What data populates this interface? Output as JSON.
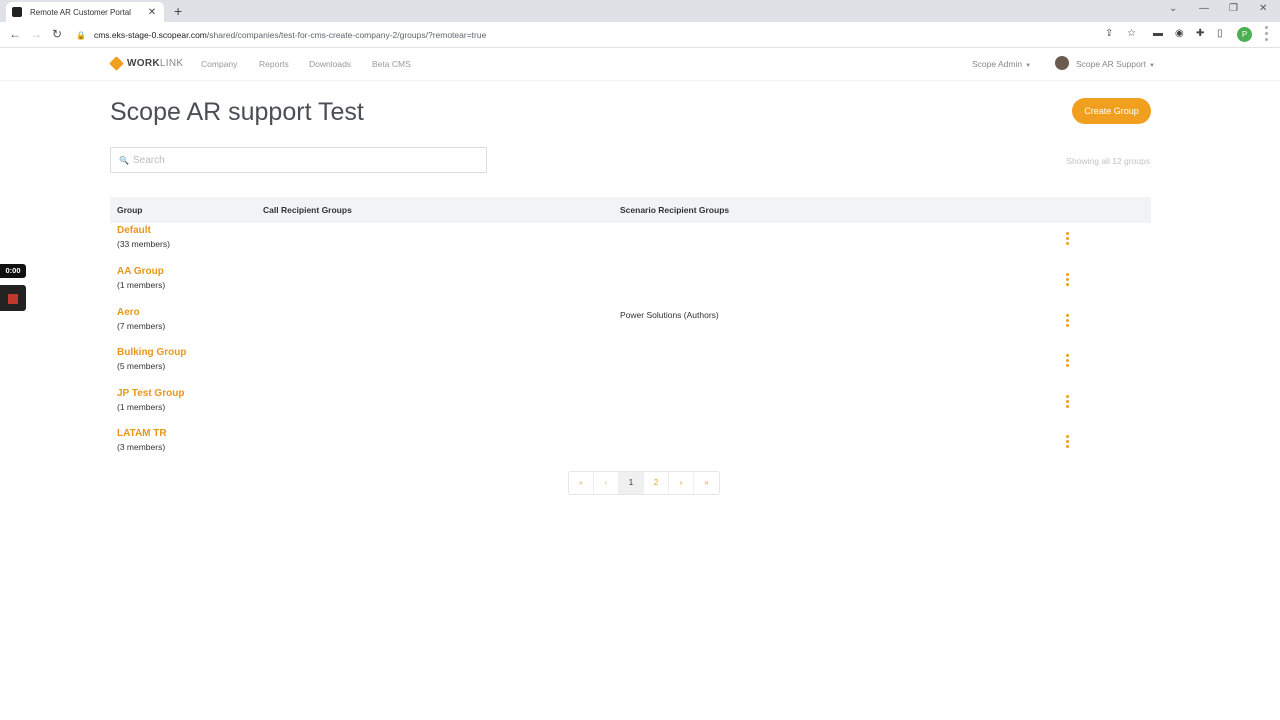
{
  "browser": {
    "tab_title": "Remote AR Customer Portal",
    "tab_close": "✕",
    "new_tab": "+",
    "url_host": "cms.eks-stage-0.scopear.com",
    "url_path": "/shared/companies/test-for-cms-create-company-2/groups/?remotear=true",
    "profile_initial": "P"
  },
  "nav": {
    "logo_bold": "WORK",
    "logo_light": "LINK",
    "links": [
      "Company",
      "Reports",
      "Downloads",
      "Beta CMS"
    ],
    "admin_menu": "Scope Admin",
    "user_menu": "Scope AR Support"
  },
  "widget": {
    "timer": "0:00"
  },
  "page": {
    "title": "Scope AR support Test",
    "create_button": "Create Group",
    "search_placeholder": "Search",
    "showing": "Showing all 12 groups"
  },
  "table": {
    "headers": [
      "Group",
      "Call Recipient Groups",
      "Scenario Recipient Groups"
    ],
    "rows": [
      {
        "name": "Default",
        "members": "(33 members)",
        "call": "",
        "scenario": ""
      },
      {
        "name": "AA Group",
        "members": "(1 members)",
        "call": "",
        "scenario": ""
      },
      {
        "name": "Aero",
        "members": "(7 members)",
        "call": "",
        "scenario": "Power Solutions (Authors)"
      },
      {
        "name": "Bulking Group",
        "members": "(5 members)",
        "call": "",
        "scenario": ""
      },
      {
        "name": "JP Test Group",
        "members": "(1 members)",
        "call": "",
        "scenario": ""
      },
      {
        "name": "LATAM TR",
        "members": "(3 members)",
        "call": "",
        "scenario": ""
      }
    ]
  },
  "pagination": {
    "first": "«",
    "prev": "‹",
    "pages": [
      "1",
      "2"
    ],
    "next": "›",
    "last": "»"
  }
}
